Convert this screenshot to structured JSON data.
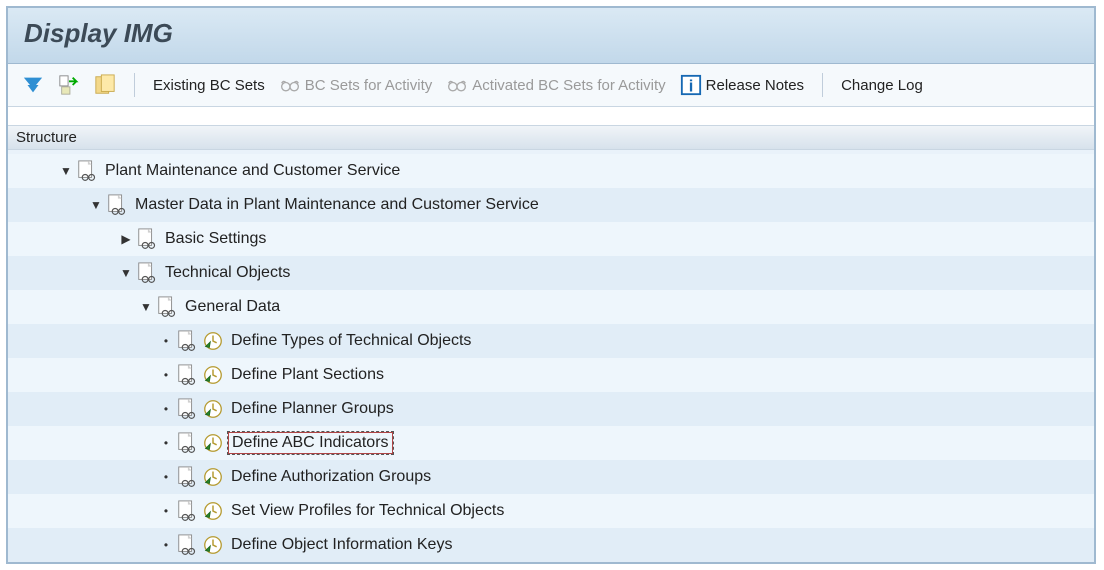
{
  "title": "Display IMG",
  "toolbar": {
    "existing_bc_sets": "Existing BC Sets",
    "bc_sets_for_activity": "BC Sets for Activity",
    "activated_bc_sets_for_activity": "Activated BC Sets for Activity",
    "release_notes": "Release Notes",
    "change_log": "Change Log"
  },
  "structure_header": "Structure",
  "tree": {
    "n0": "Plant Maintenance and Customer Service",
    "n1": "Master Data in Plant Maintenance and Customer Service",
    "n2": "Basic Settings",
    "n3": "Technical Objects",
    "n4": "General Data",
    "n5": "Define Types of Technical Objects",
    "n6": "Define Plant Sections",
    "n7": "Define Planner Groups",
    "n8": "Define ABC Indicators",
    "n9": "Define Authorization Groups",
    "n10": "Set View Profiles for Technical Objects",
    "n11": "Define Object Information Keys"
  }
}
